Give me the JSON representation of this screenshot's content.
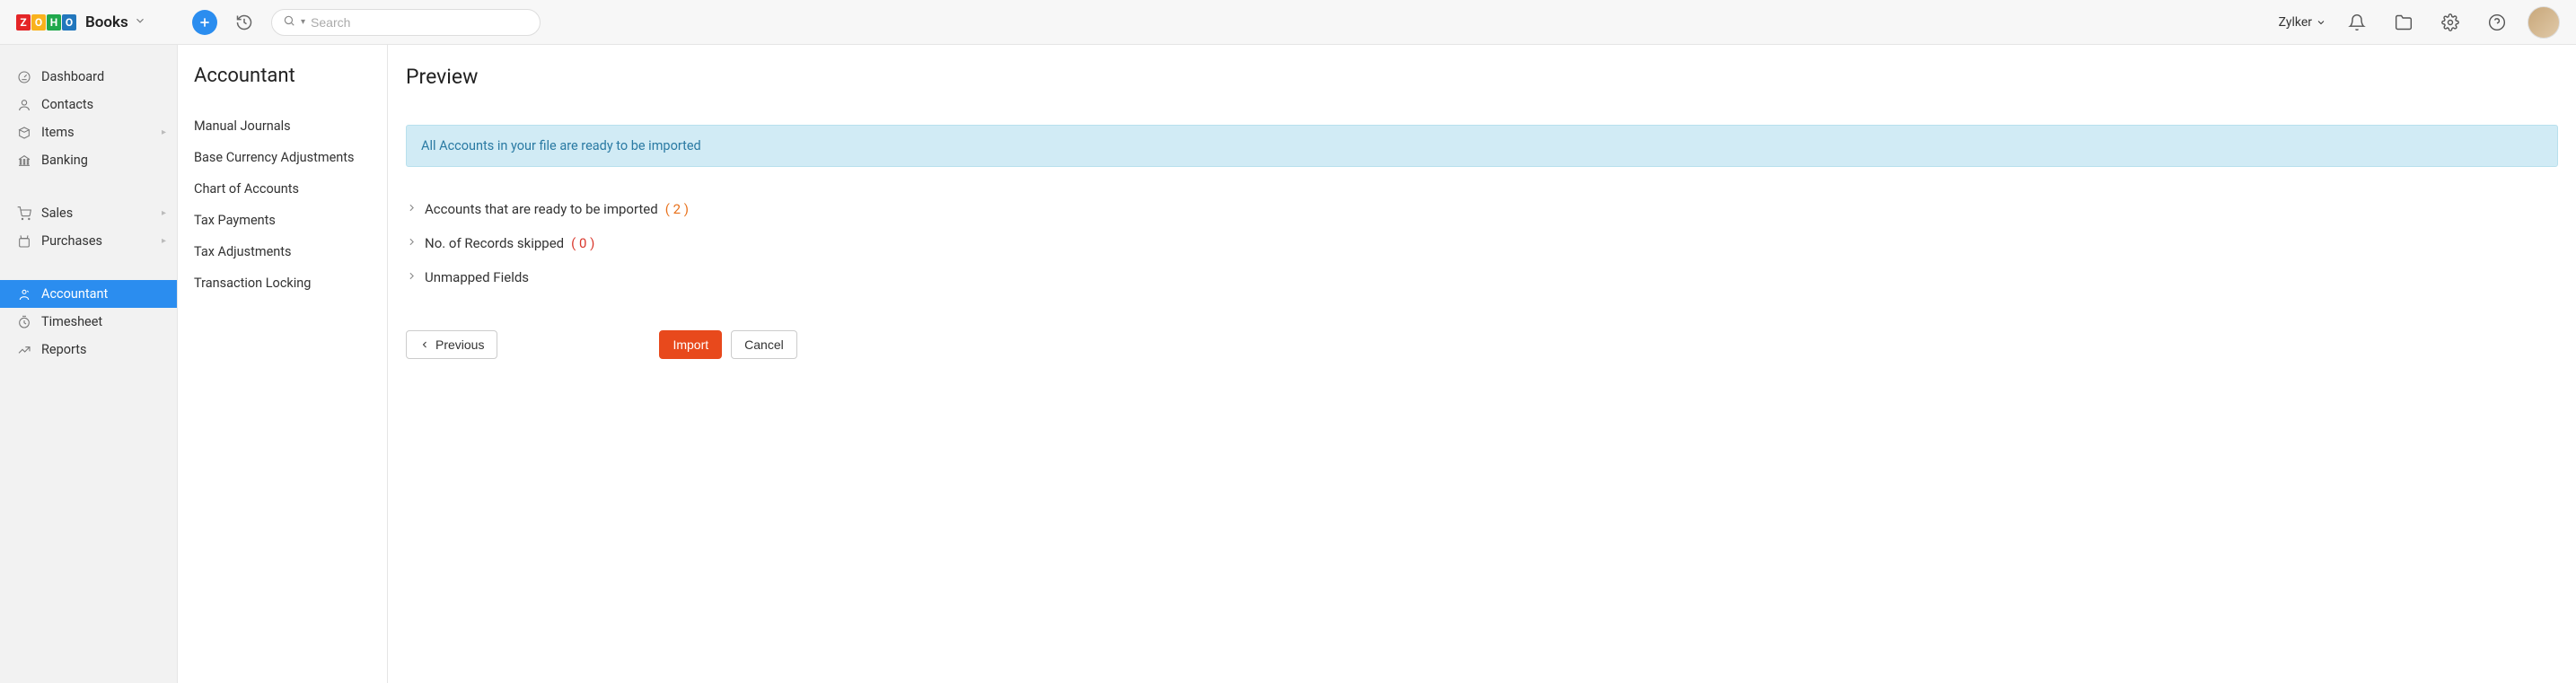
{
  "header": {
    "brand": "Books",
    "search_placeholder": "Search",
    "org_name": "Zylker"
  },
  "leftnav": {
    "items": [
      {
        "label": "Dashboard",
        "expandable": false
      },
      {
        "label": "Contacts",
        "expandable": false
      },
      {
        "label": "Items",
        "expandable": true
      },
      {
        "label": "Banking",
        "expandable": false
      }
    ],
    "items2": [
      {
        "label": "Sales",
        "expandable": true
      },
      {
        "label": "Purchases",
        "expandable": true
      }
    ],
    "items3": [
      {
        "label": "Accountant",
        "expandable": false,
        "active": true
      },
      {
        "label": "Timesheet",
        "expandable": false
      },
      {
        "label": "Reports",
        "expandable": false
      }
    ]
  },
  "subnav": {
    "title": "Accountant",
    "items": [
      "Manual Journals",
      "Base Currency Adjustments",
      "Chart of Accounts",
      "Tax Payments",
      "Tax Adjustments",
      "Transaction Locking"
    ]
  },
  "main": {
    "title": "Preview",
    "banner": "All Accounts in your file are ready to be imported",
    "rows": [
      {
        "label": "Accounts that are ready to be imported",
        "count": "( 2 )",
        "cls": "count-orange"
      },
      {
        "label": "No. of Records skipped",
        "count": "( 0 )",
        "cls": "count-red"
      },
      {
        "label": "Unmapped Fields",
        "count": "",
        "cls": ""
      }
    ],
    "buttons": {
      "previous": "Previous",
      "import": "Import",
      "cancel": "Cancel"
    }
  }
}
